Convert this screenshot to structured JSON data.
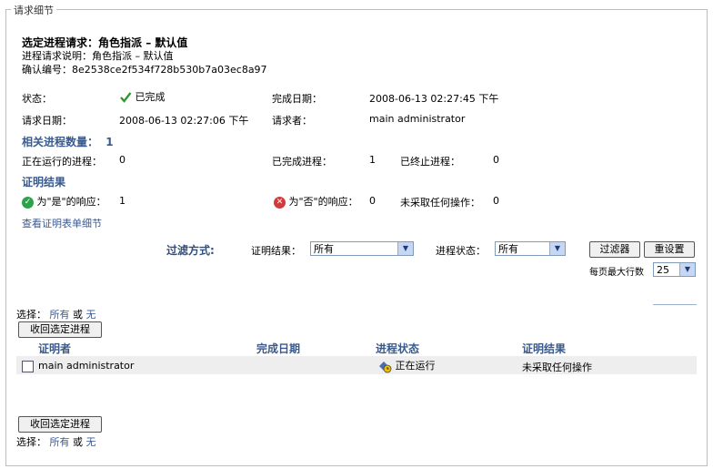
{
  "legend": "请求细节",
  "title": {
    "label": "选定进程请求：",
    "value": "角色指派 – 默认值"
  },
  "description": {
    "label": "进程请求说明：",
    "value": "角色指派 – 默认值"
  },
  "confirmation": {
    "label": "确认编号：",
    "value": "8e2538ce2f534f728b530b7a03ec8a97"
  },
  "status": {
    "label": "状态：",
    "value": "已完成"
  },
  "completion_date": {
    "label": "完成日期：",
    "value": "2008-06-13 02:27:45 下午"
  },
  "request_date": {
    "label": "请求日期：",
    "value": "2008-06-13 02:27:06 下午"
  },
  "requester": {
    "label": "请求者：",
    "value": "main administrator"
  },
  "related": {
    "label": "相关进程数量：",
    "value": "1"
  },
  "running": {
    "label": "正在运行的进程：",
    "value": "0"
  },
  "completed": {
    "label": "已完成进程：",
    "value": "1"
  },
  "terminated": {
    "label": "已终止进程：",
    "value": "0"
  },
  "proof_section": "证明结果",
  "yes_resp": {
    "label": "为\"是\"的响应：",
    "value": "1"
  },
  "no_resp": {
    "label": "为\"否\"的响应：",
    "value": "0"
  },
  "no_action": {
    "label": "未采取任何操作：",
    "value": "0"
  },
  "view_form_link": "查看证明表单细节",
  "filter": {
    "title": "过滤方式:",
    "result_label": "证明结果：",
    "result_value": "所有",
    "state_label": "进程状态：",
    "state_value": "所有",
    "filter_button": "过滤器",
    "reset_button": "重设置",
    "per_page_label": "每页最大行数",
    "per_page_value": "25"
  },
  "select_top": {
    "label": "选择：",
    "all": "所有",
    "or": "或",
    "none": "无"
  },
  "retract_button": "收回选定进程",
  "columns": [
    "证明者",
    "完成日期",
    "进程状态",
    "证明结果"
  ],
  "rows": [
    {
      "attester": "main administrator",
      "date": "",
      "state": "正在运行",
      "result": "未采取任何操作"
    }
  ],
  "select_bottom": {
    "label": "选择：",
    "all": "所有",
    "or": "或",
    "none": "无"
  },
  "colors": {
    "link": "#3a5a90",
    "section": "#3a5a8c",
    "border": "#bdbdbd"
  }
}
